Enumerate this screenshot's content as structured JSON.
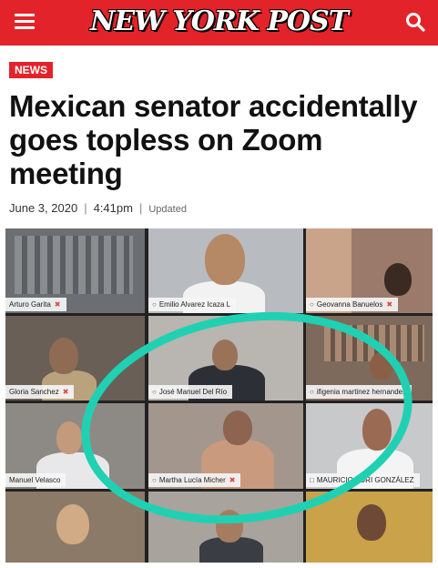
{
  "header": {
    "brand": "NEW YORK POST",
    "brand_color": "#e2232a",
    "menu_icon": "hamburger-menu-icon",
    "search_icon": "search-icon"
  },
  "article": {
    "section_tag": "NEWS",
    "headline": "Mexican senator accidentally goes topless on Zoom meeting",
    "date": "June 3, 2020",
    "time": "4:41pm",
    "updated_label": "Updated"
  },
  "photo": {
    "highlight_color": "#1fd1b2",
    "participants": [
      "Arturo Garita",
      "Emilio Alvarez Icaza L",
      "Geovanna Banuelos",
      "Gloria Sanchez",
      "José Manuel Del Río",
      "ifigenia martinez hernandez",
      "Manuel Velasco",
      "Martha Lucía Micher",
      "MAURICIO KURI GONZÁLEZ"
    ]
  }
}
